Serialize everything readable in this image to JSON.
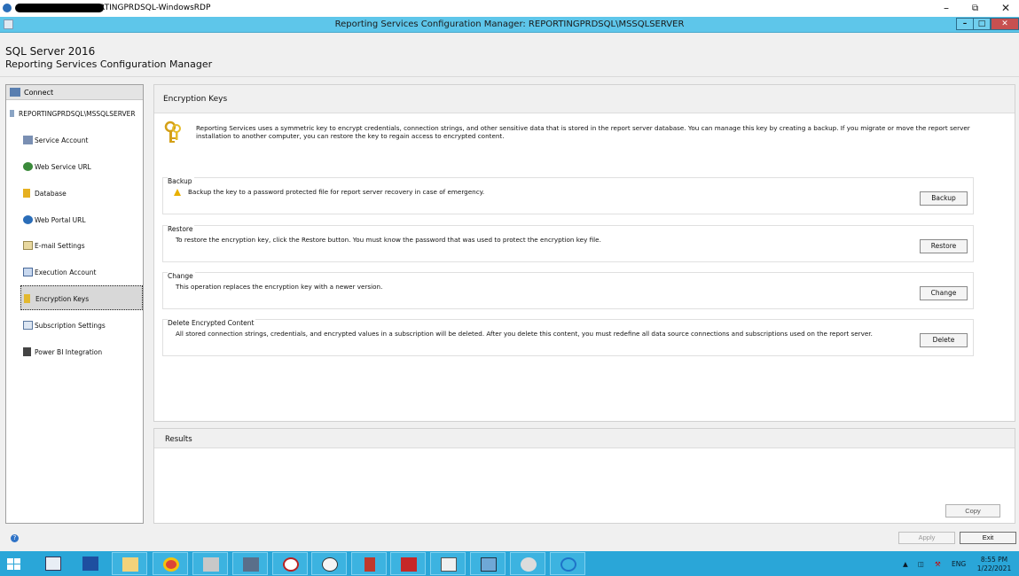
{
  "rdp_window": {
    "title": "RTINGPRDSQL-WindowsRDP"
  },
  "app_window": {
    "title": "Reporting Services Configuration Manager: REPORTINGPRDSQL\\MSSQLSERVER"
  },
  "header": {
    "product": "SQL Server 2016",
    "subtitle": "Reporting Services Configuration Manager"
  },
  "sidebar": {
    "connect_label": "Connect",
    "server": "REPORTINGPRDSQL\\MSSQLSERVER",
    "items": [
      {
        "label": "Service Account",
        "icon": "service-account-icon",
        "active": false
      },
      {
        "label": "Web Service URL",
        "icon": "web-service-url-icon",
        "active": false
      },
      {
        "label": "Database",
        "icon": "database-icon",
        "active": false
      },
      {
        "label": "Web Portal URL",
        "icon": "web-portal-icon",
        "active": false
      },
      {
        "label": "E-mail Settings",
        "icon": "email-icon",
        "active": false
      },
      {
        "label": "Execution Account",
        "icon": "execution-account-icon",
        "active": false
      },
      {
        "label": "Encryption Keys",
        "icon": "key-icon",
        "active": true
      },
      {
        "label": "Subscription Settings",
        "icon": "subscription-icon",
        "active": false
      },
      {
        "label": "Power BI Integration",
        "icon": "power-bi-icon",
        "active": false
      }
    ]
  },
  "main": {
    "title": "Encryption Keys",
    "intro": "Reporting Services uses a symmetric key to encrypt credentials, connection strings, and other sensitive data that is stored in the report server database.  You can manage this key by creating a backup.  If you migrate or move the report server installation to another computer, you can restore the key to regain access to encrypted content.",
    "sections": [
      {
        "title": "Backup",
        "description": "Backup the key to a password protected file for report server recovery in case of emergency.",
        "button": "Backup",
        "warning": true
      },
      {
        "title": "Restore",
        "description": "To restore the encryption key, click the Restore button.  You must know the password that was used to protect the encryption key file.",
        "button": "Restore",
        "warning": false
      },
      {
        "title": "Change",
        "description": "This operation replaces the encryption key with a newer version.",
        "button": "Change",
        "warning": false
      },
      {
        "title": "Delete Encrypted Content",
        "description": "All stored connection strings, credentials, and encrypted values in a subscription will be deleted.  After you delete this content, you must redefine all data source connections and subscriptions used on the report server.",
        "button": "Delete",
        "warning": false
      }
    ]
  },
  "results": {
    "title": "Results",
    "copy_label": "Copy"
  },
  "footer": {
    "apply_label": "Apply",
    "exit_label": "Exit"
  },
  "taskbar": {
    "language": "ENG",
    "time": "8:55 PM",
    "date": "1/22/2021",
    "accent": "#2aa6d8"
  }
}
